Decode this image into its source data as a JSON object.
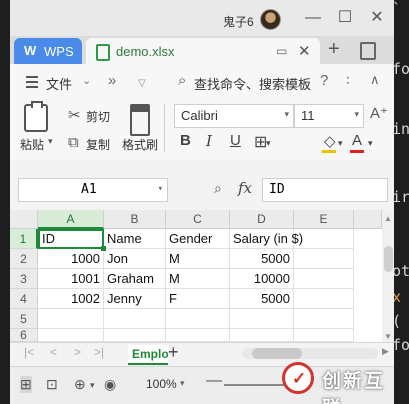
{
  "backdrop": {
    "lines": [
      "`",
      "for",
      "ing",
      "ir",
      "ot",
      "x",
      "(",
      "fo"
    ]
  },
  "titlebar": {
    "user": "鬼子6",
    "minimize": "—",
    "maximize": "☐",
    "close": "✕"
  },
  "tabs": {
    "home": {
      "logo": "W",
      "label": "WPS"
    },
    "doc": {
      "label": "demo.xlsx",
      "monitor": "▭",
      "close": "✕"
    },
    "add": "+"
  },
  "menu": {
    "file_label": "文件",
    "chevron": "⌄",
    "more": "»",
    "caret": "▽",
    "search_icon": "⌕",
    "search_label": "查找命令、搜索模板",
    "help": "?",
    "dots": "∶",
    "collapse": "∧"
  },
  "toolbar": {
    "paste_label": "粘贴",
    "paste_dd": "▾",
    "cut_label": "剪切",
    "copy_label": "复制",
    "format_painter_label": "格式刷",
    "font": "Calibri",
    "size": "11",
    "dd": "▾",
    "bold": "B",
    "italic": "I",
    "underline": "U",
    "border": "⊞",
    "fill": "◇",
    "font_color": "A",
    "grow": "A⁺",
    "cut_icon": "✂",
    "copy_icon": "⧉"
  },
  "formula": {
    "cell_ref": "A1",
    "zoom_icon": "⌕",
    "fx": "fx",
    "value": "ID"
  },
  "grid": {
    "columns": [
      "A",
      "B",
      "C",
      "D",
      "E"
    ],
    "rows": [
      "1",
      "2",
      "3",
      "4",
      "5",
      "6"
    ],
    "cells": [
      [
        "ID",
        "Name",
        "Gender",
        "Salary (in $)",
        ""
      ],
      [
        "1000",
        "Jon",
        "M",
        "5000",
        ""
      ],
      [
        "1001",
        "Graham",
        "M",
        "10000",
        ""
      ],
      [
        "1002",
        "Jenny",
        "F",
        "5000",
        ""
      ],
      [
        "",
        "",
        "",
        "",
        ""
      ],
      [
        "",
        "",
        "",
        "",
        ""
      ]
    ],
    "active_cell": "A1"
  },
  "sheets": {
    "nav": [
      "|<",
      "<",
      ">",
      ">|"
    ],
    "tab": "Employees",
    "add": "+"
  },
  "status": {
    "zoom": "100%",
    "zoom_dd": "▾",
    "minus": "—"
  },
  "watermark": {
    "text": "创新互联",
    "mark": "✓"
  },
  "colors": {
    "accent": "#1f8a3a",
    "wps_blue": "#4a8ae8",
    "watermark_red": "#d6322e"
  }
}
